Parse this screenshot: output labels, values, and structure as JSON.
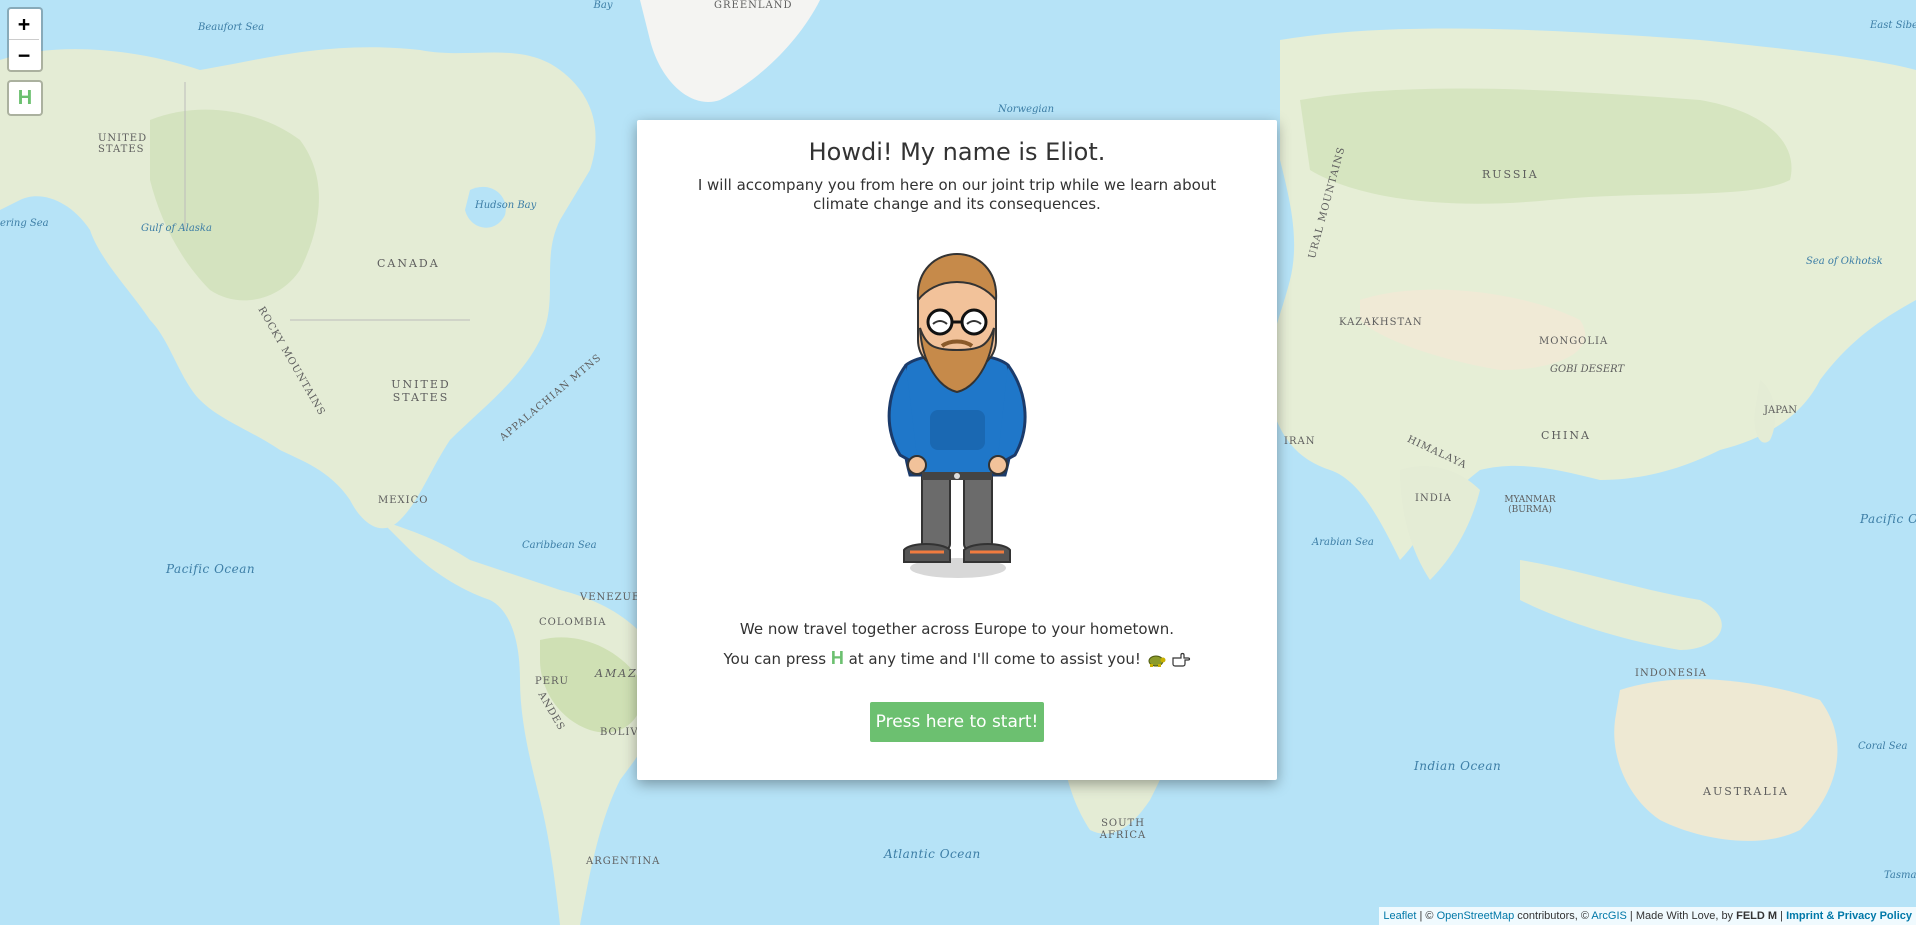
{
  "map": {
    "controls": {
      "zoom_in": "+",
      "zoom_out": "−",
      "help": "H"
    },
    "labels": {
      "greenland": "GREENLAND",
      "beaufort_sea": "Beaufort Sea",
      "united_states_ak": "UNITED STATES",
      "bering_sea": "ering Sea",
      "gulf_alaska": "Gulf of Alaska",
      "canada": "CANADA",
      "hudson_bay": "Hudson Bay",
      "baffin_bay": "Bay",
      "rocky_mountains": "ROCKY MOUNTAINS",
      "united_states": "UNITED STATES",
      "appalachian": "APPALACHIAN MTNS",
      "mexico": "MEXICO",
      "pacific_ocean_w": "Pacific Ocean",
      "caribbean_sea": "Caribbean Sea",
      "venezuela": "VENEZUELA",
      "colombia": "COLOMBIA",
      "peru": "PERU",
      "amazon": "AMAZO",
      "andes": "ANDES",
      "bolivia": "BOLIV",
      "argentina": "ARGENTINA",
      "atlantic_ocean": "Atlantic Ocean",
      "south_africa": "SOUTH AFRICA",
      "norwegian": "Norwegian",
      "russia": "RUSSIA",
      "ural_mountains": "URAL MOUNTAINS",
      "kazakhstan": "KAZAKHSTAN",
      "mongolia": "MONGOLIA",
      "gobi_desert": "GOBI DESERT",
      "east_siberian": "East Siberian Sea",
      "sea_okhotsk": "Sea of Okhotsk",
      "iran": "IRAN",
      "himalaya": "HIMALAYA",
      "china": "CHINA",
      "japan": "JAPAN",
      "india": "INDIA",
      "myanmar": "MYANMAR (BURMA)",
      "arabian_sea": "Arabian Sea",
      "pacific_ocean_e": "Pacific Ocean",
      "indonesia": "INDONESIA",
      "indian_ocean": "Indian Ocean",
      "coral_sea": "Coral Sea",
      "australia": "AUSTRALIA",
      "tasman": "Tasmar"
    },
    "attribution": {
      "leaflet": "Leaflet",
      "sep1": " | © ",
      "osm": "OpenStreetMap",
      "contributors": " contributors, © ",
      "arcgis": "ArcGIS",
      "made_with": " | Made With Love, by ",
      "feld": "FELD M",
      "sep2": " | ",
      "imprint": "Imprint & Privacy Policy"
    }
  },
  "modal": {
    "title": "Howdi! My name is Eliot.",
    "intro": "I will accompany you from here on our joint trip while we learn about climate change and its consequences.",
    "line1": "We now travel together across Europe to your hometown.",
    "line2_before": "You can press ",
    "line2_key": "H",
    "line2_after": " at any time and I'll come to assist you! ",
    "start_button": "Press here to start!",
    "icons": [
      "turtle-icon",
      "pointing-hand-icon"
    ]
  }
}
